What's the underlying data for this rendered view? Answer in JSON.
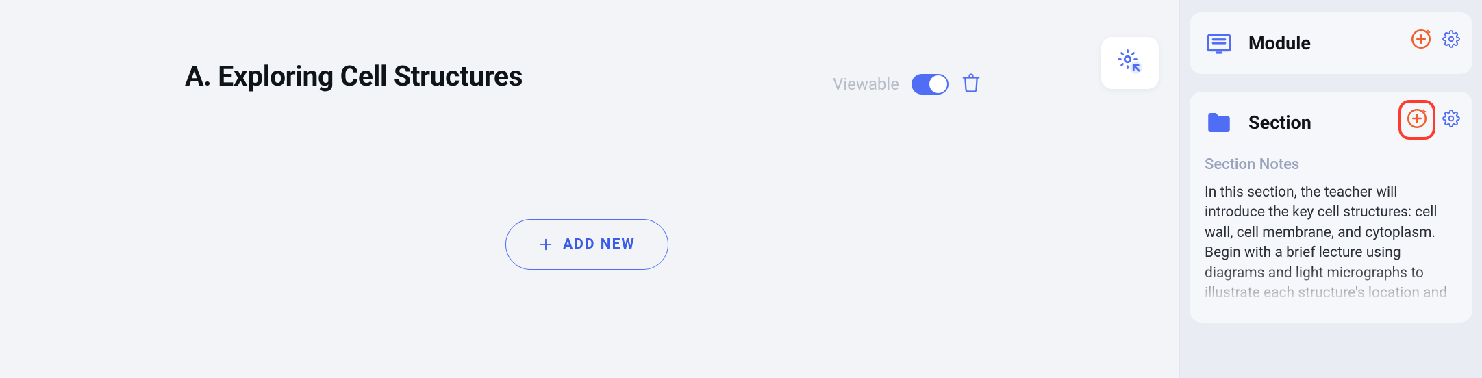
{
  "main": {
    "title": "A. Exploring Cell Structures",
    "viewable_label": "Viewable",
    "add_new_label": "ADD NEW"
  },
  "sidebar": {
    "module": {
      "title": "Module"
    },
    "section": {
      "title": "Section",
      "notes_heading": "Section Notes",
      "notes_body": "In this section, the teacher will introduce the key cell structures: cell wall, cell membrane, and cytoplasm. Begin with a brief lecture using diagrams and light micrographs to illustrate each structure's location and function. Next, guide students"
    }
  }
}
